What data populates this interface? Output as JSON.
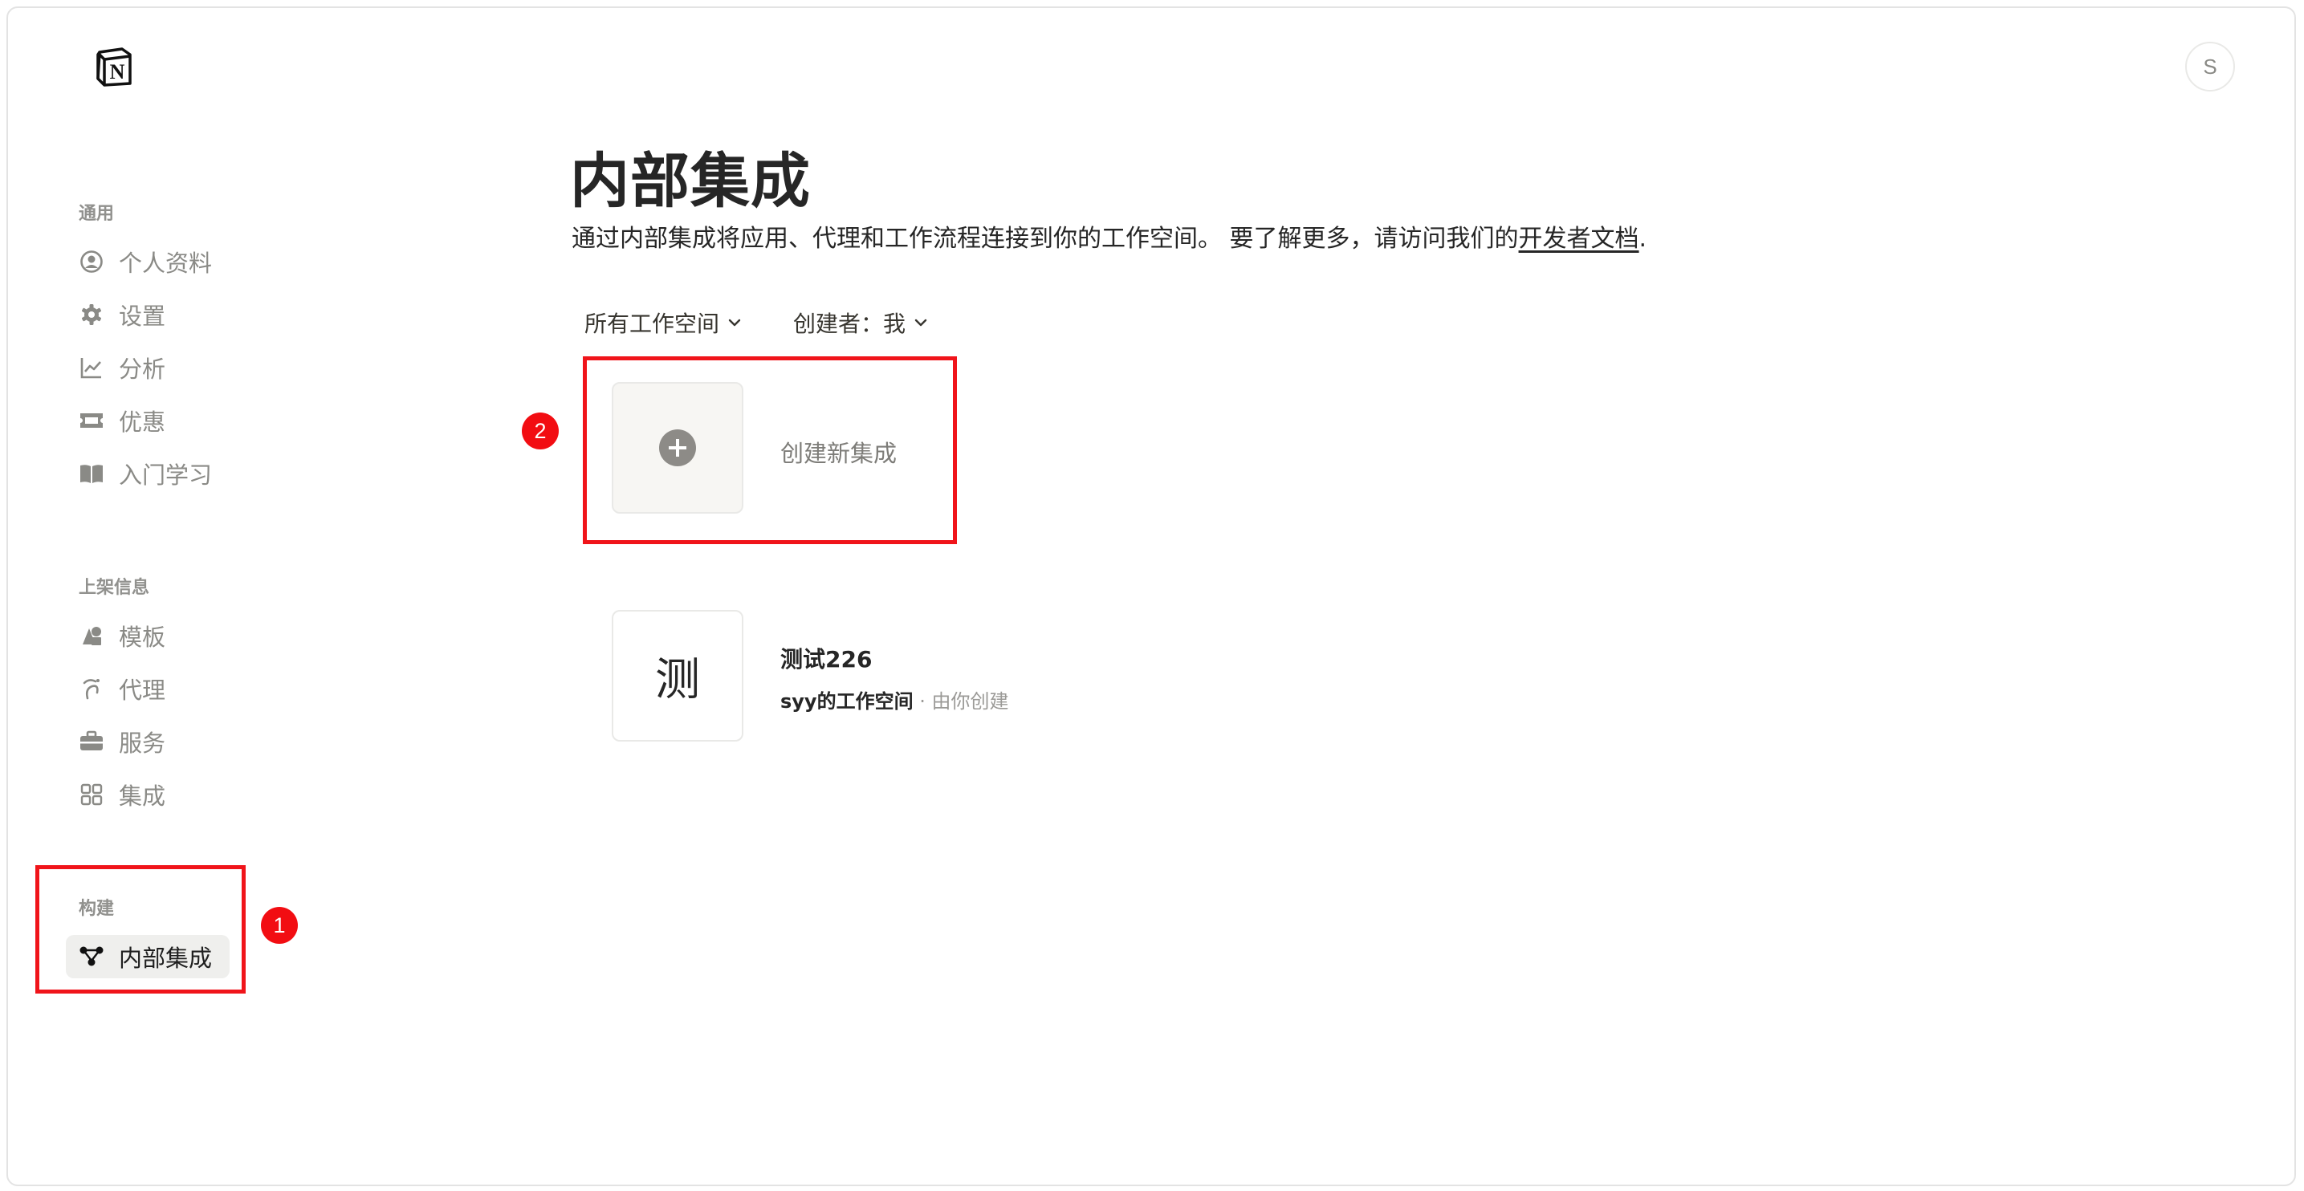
{
  "app": {
    "logo_letter": "N",
    "avatar_letter": "S"
  },
  "sidebar": {
    "sections": [
      {
        "label": "通用",
        "items": [
          {
            "label": "个人资料",
            "icon": "person-circle-icon"
          },
          {
            "label": "设置",
            "icon": "gear-icon"
          },
          {
            "label": "分析",
            "icon": "chart-line-icon"
          },
          {
            "label": "优惠",
            "icon": "ticket-icon"
          },
          {
            "label": "入门学习",
            "icon": "book-icon"
          }
        ]
      },
      {
        "label": "上架信息",
        "items": [
          {
            "label": "模板",
            "icon": "shapes-icon"
          },
          {
            "label": "代理",
            "icon": "agent-icon"
          },
          {
            "label": "服务",
            "icon": "briefcase-icon"
          },
          {
            "label": "集成",
            "icon": "grid-icon"
          }
        ]
      },
      {
        "label": "构建",
        "items": [
          {
            "label": "内部集成",
            "icon": "nodes-icon",
            "active": true
          }
        ]
      }
    ]
  },
  "main": {
    "title": "内部集成",
    "subtitle": "通过内部集成将应用、代理和工作流程连接到你的工作空间。 要了解更多，请访问我们的",
    "subtitle_link": "开发者文档",
    "subtitle_end": ".",
    "filters": {
      "workspace": "所有工作空间",
      "creator": "创建者：我"
    },
    "create_card": {
      "label": "创建新集成"
    },
    "integrations": [
      {
        "icon_char": "测",
        "name": "测试226",
        "workspace": "syy的工作空间",
        "separator": " · ",
        "created_by": "由你创建"
      }
    ]
  },
  "annotations": {
    "badge_1": "1",
    "badge_2": "2",
    "color": "#f0141a"
  }
}
